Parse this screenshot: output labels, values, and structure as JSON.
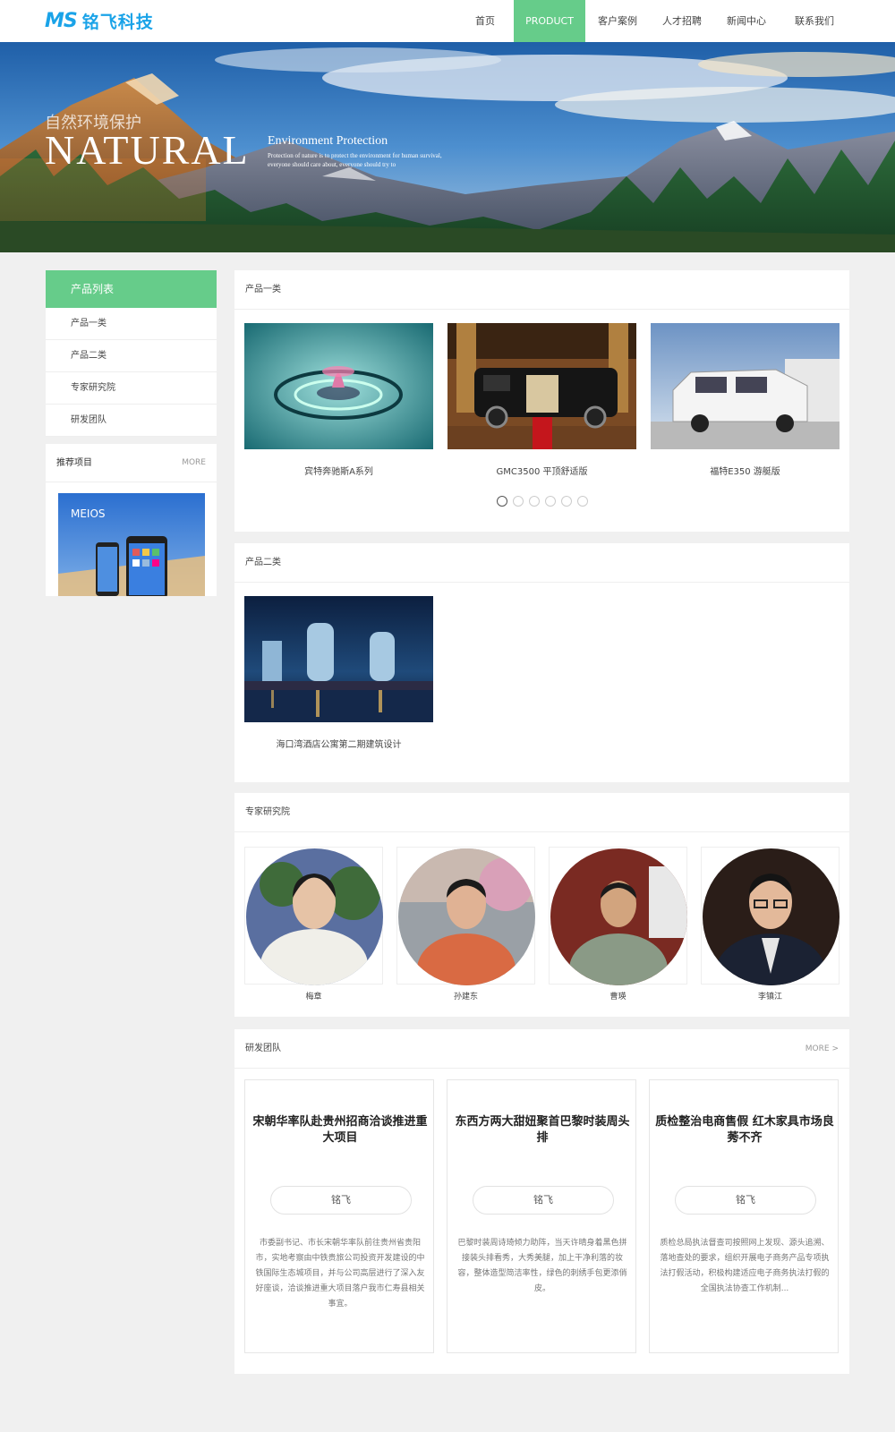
{
  "header": {
    "logo_mark": "MS",
    "logo_text": "铭飞科技",
    "nav": [
      {
        "label": "首页"
      },
      {
        "label": "PRODUCT"
      },
      {
        "label": "客户案例"
      },
      {
        "label": "人才招聘"
      },
      {
        "label": "新闻中心"
      },
      {
        "label": "联系我们"
      }
    ]
  },
  "banner": {
    "cn_title": "自然环境保护",
    "big_title": "NATURAL",
    "sub_title": "Environment Protection",
    "line1": "Protection of nature is to protect the environment for human survival,",
    "line2": "everyone should care about, everyone should try to"
  },
  "sidebar": {
    "title": "产品列表",
    "items": [
      {
        "label": "产品一类"
      },
      {
        "label": "产品二类"
      },
      {
        "label": "专家研究院"
      },
      {
        "label": "研发团队"
      }
    ],
    "recommend": {
      "title": "推荐项目",
      "more": "MORE",
      "image_text": "MEIOS"
    }
  },
  "products1": {
    "title": "产品一类",
    "items": [
      {
        "caption": "宾特奔驰斯A系列"
      },
      {
        "caption": "GMC3500 平顶舒适版"
      },
      {
        "caption": "福特E350 游艇版"
      }
    ]
  },
  "products2": {
    "title": "产品二类",
    "items": [
      {
        "caption": "海口湾酒店公寓第二期建筑设计"
      }
    ]
  },
  "experts": {
    "title": "专家研究院",
    "items": [
      {
        "name": "梅章"
      },
      {
        "name": "孙建东"
      },
      {
        "name": "曹瑛"
      },
      {
        "name": "李镇江"
      }
    ]
  },
  "team": {
    "title": "研发团队",
    "more": "MORE >",
    "items": [
      {
        "title": "宋朝华率队赴贵州招商洽谈推进重大项目",
        "button": "铭飞",
        "desc": "市委副书记、市长宋朝华率队前往贵州省贵阳市，实地考察由中铁贵旅公司投资开发建设的中铁国际生态城项目，并与公司高层进行了深入友好座谈，洽谈推进重大项目落户我市仁寿县相关事宜。"
      },
      {
        "title": "东西方两大甜妞聚首巴黎时装周头排",
        "button": "铭飞",
        "desc": "巴黎时装周诗琦倾力助阵，当天许晴身着黑色拼接装头排看秀，大秀美腿，加上干净利落的妆容，整体造型简洁率性，绿色的刺绣手包更添俏皮。"
      },
      {
        "title": "质检整治电商售假 红木家具市场良莠不齐",
        "button": "铭飞",
        "desc": "质检总局执法督查司按照网上发现、源头追溯、落地查处的要求，组织开展电子商务产品专项执法打假活动，积极构建适应电子商务执法打假的全国执法协查工作机制..."
      }
    ]
  },
  "colors": {
    "accent": "#66cc8a",
    "brand": "#1aa3e8"
  }
}
